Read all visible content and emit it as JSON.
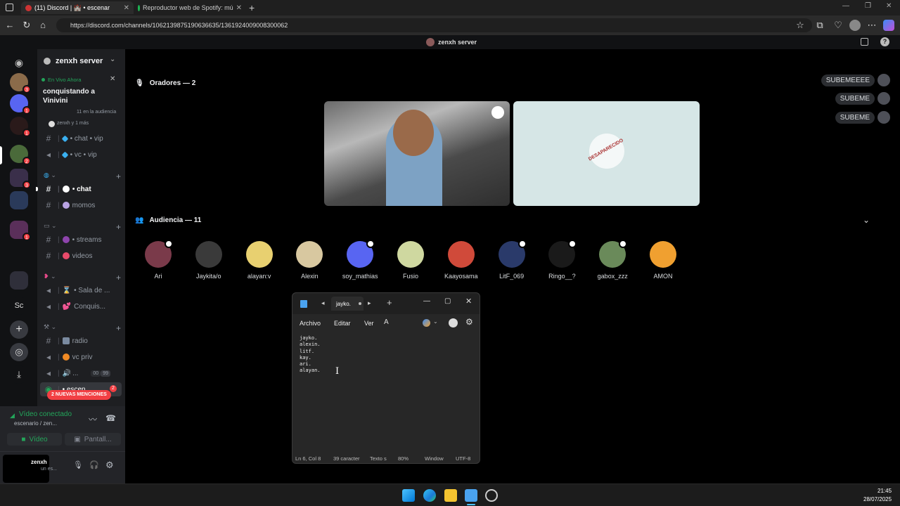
{
  "browser": {
    "tabs": [
      {
        "label": "(11) Discord | 🏰 • escenar"
      },
      {
        "label": "Reproductor web de Spotify: mú"
      }
    ],
    "url": "https://discord.com/channels/1062139875190636635/1361924009008300062"
  },
  "topbar": {
    "server_label": "zenxh server"
  },
  "servers": {
    "badges": [
      "3",
      "1",
      "1",
      "2",
      "3",
      "1"
    ],
    "sc_label": "Sc"
  },
  "sidebar": {
    "server_name": "zenxh server",
    "live_label": "En Vivo Ahora",
    "stage_title": "conquistando a Vinivini",
    "audience_info": "11 en la audiencia",
    "people_info": "zenxh y 1 más",
    "channels": [
      {
        "label": "chat",
        "suffix": "vip",
        "prefix": "•"
      },
      {
        "label": "vc",
        "suffix": "vip",
        "prefix": "•"
      },
      {
        "label": "chat",
        "prefix": "•"
      },
      {
        "label": "momos"
      },
      {
        "label": "streams",
        "prefix": "•"
      },
      {
        "label": "videos"
      },
      {
        "label": "Sala de ...",
        "prefix": "•"
      },
      {
        "label": "Conquis..."
      },
      {
        "label": "radio"
      },
      {
        "label": "vc priv"
      },
      {
        "label": "...",
        "count_a": "00",
        "count_b": "99"
      },
      {
        "label": "escen"
      }
    ],
    "mentions_badge": "2 NUEVAS MENCIONES",
    "mentions_count": "2"
  },
  "voice_panel": {
    "status": "Vídeo conectado",
    "location": "escenario / zen...",
    "video_label": "Vídeo",
    "screen_label": "Pantall..."
  },
  "user_panel": {
    "username": "zenxh",
    "status": "un es..."
  },
  "stage": {
    "speakers_heading": "Oradores — 2",
    "disappeared_label": "DESAPARECIDO",
    "audience_heading": "Audiencia — 11",
    "audience": [
      "Ari",
      "Jaykita/o",
      "alayan:v",
      "Alexin",
      "soy_mathias",
      "Fusio",
      "Kaayosama",
      "LitF_069",
      "Ringo__?",
      "gabox_zzz",
      "AMON"
    ],
    "chips": [
      "SUBEMEEEE",
      "SUBEME",
      "SUBEME"
    ]
  },
  "notepad": {
    "tab_title": "jayko.",
    "menu": [
      "Archivo",
      "Editar",
      "Ver"
    ],
    "text": "jayko.\nalexin.\nlitf.\nkay.\nari.\nalayan.",
    "status": {
      "position": "Ln 6, Col 8",
      "chars": "39 caracter",
      "format": "Texto s",
      "zoom": "80%",
      "line_ending": "Window",
      "encoding": "UTF-8"
    }
  },
  "taskbar": {
    "time": "21:45",
    "date": "28/07/2025"
  },
  "colors": {
    "stage_bg": "#000000",
    "sidebar_bg": "#1e1f22",
    "rail_bg": "#111214",
    "live_green": "#23a55a",
    "badge_red": "#f23f43",
    "speaker_tile": "#d6e6e6"
  }
}
